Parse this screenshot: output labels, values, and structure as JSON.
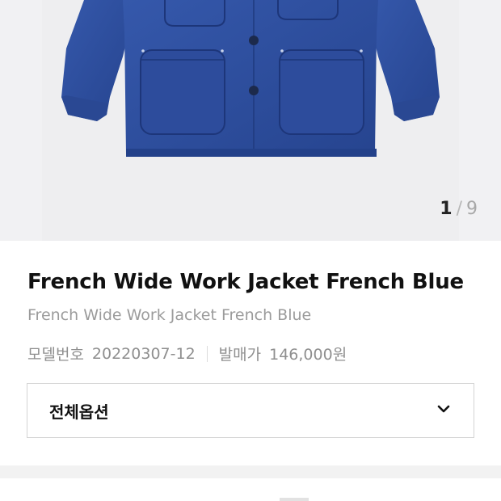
{
  "gallery": {
    "image_alt": "Blue work jacket",
    "current_index": "1",
    "separator": "/",
    "total": "9"
  },
  "product": {
    "title": "French Wide Work Jacket French Blue",
    "subtitle": "French Wide Work Jacket French Blue",
    "model_label": "모델번호",
    "model_number": "20220307-12",
    "price_label": "발매가",
    "price": "146,000원"
  },
  "options": {
    "label": "전체옵션",
    "icon": "chevron-down-icon"
  },
  "colors": {
    "jacket_blue": "#2f4fa0",
    "background_gray": "#f1f1f3"
  }
}
